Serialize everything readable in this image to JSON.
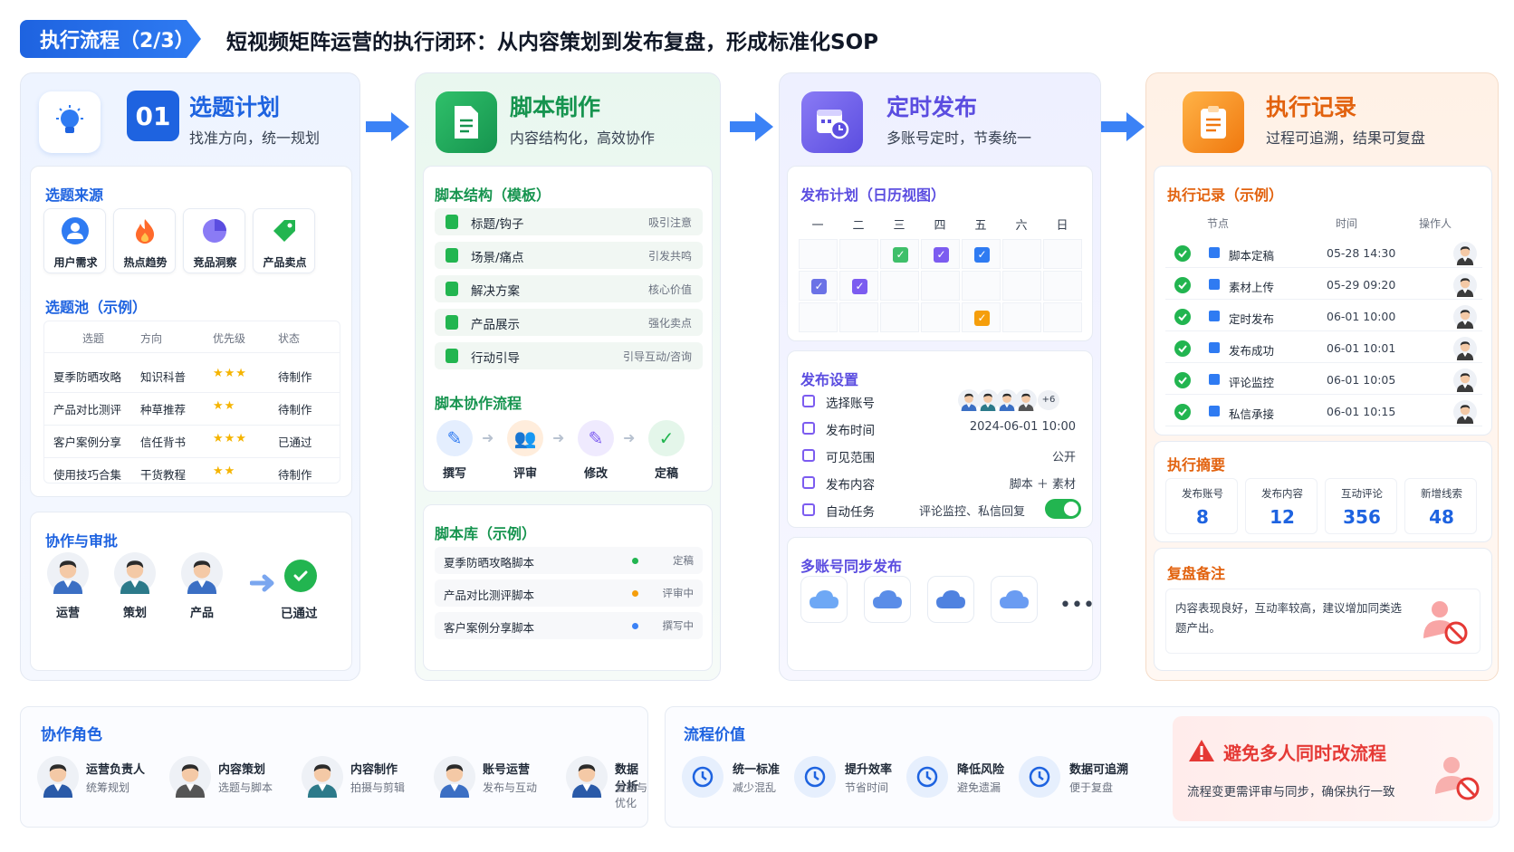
{
  "header": {
    "badge": "执行流程（2/3）",
    "title": "短视频矩阵运营的执行闭环：从内容策划到发布复盘，形成标准化SOP"
  },
  "colors": {
    "blue": "#1e63e0",
    "green": "#16944f",
    "purple": "#5b4de0",
    "orange": "#e2620e"
  },
  "step1": {
    "num": "01",
    "title": "选题计划",
    "subtitle": "找准方向，统一规划",
    "source_title": "选题来源",
    "sources": [
      {
        "label": "用户需求",
        "icon": "user-icon"
      },
      {
        "label": "热点趋势",
        "icon": "fire-icon"
      },
      {
        "label": "竞品洞察",
        "icon": "pie-chart-icon"
      },
      {
        "label": "产品卖点",
        "icon": "tag-icon"
      }
    ],
    "pool_title": "选题池（示例）",
    "pool_headers": [
      "选题",
      "方向",
      "优先级",
      "状态"
    ],
    "pool_rows": [
      {
        "topic": "夏季防晒攻略",
        "dir": "知识科普",
        "prio": "★★★",
        "status": "待制作"
      },
      {
        "topic": "产品对比测评",
        "dir": "种草推荐",
        "prio": "★★",
        "status": "待制作"
      },
      {
        "topic": "客户案例分享",
        "dir": "信任背书",
        "prio": "★★★",
        "status": "已通过"
      },
      {
        "topic": "使用技巧合集",
        "dir": "干货教程",
        "prio": "★★",
        "status": "待制作"
      }
    ],
    "approve_title": "协作与审批",
    "approvers": [
      "运营",
      "策划",
      "产品"
    ],
    "approved": "已通过"
  },
  "step2": {
    "title": "脚本制作",
    "subtitle": "内容结构化，高效协作",
    "struct_title": "脚本结构（模板）",
    "struct": [
      {
        "label": "标题/钩子",
        "note": "吸引注意"
      },
      {
        "label": "场景/痛点",
        "note": "引发共鸣"
      },
      {
        "label": "解决方案",
        "note": "核心价值"
      },
      {
        "label": "产品展示",
        "note": "强化卖点"
      },
      {
        "label": "行动引导",
        "note": "引导互动/咨询"
      }
    ],
    "flow_title": "脚本协作流程",
    "flow": [
      "撰写",
      "评审",
      "修改",
      "定稿"
    ],
    "lib_title": "脚本库（示例）",
    "lib": [
      {
        "name": "夏季防晒攻略脚本",
        "status": "定稿",
        "color": "#22b550"
      },
      {
        "name": "产品对比测评脚本",
        "status": "评审中",
        "color": "#f59e0b"
      },
      {
        "name": "客户案例分享脚本",
        "status": "撰写中",
        "color": "#3b82f6"
      }
    ]
  },
  "step3": {
    "title": "定时发布",
    "subtitle": "多账号定时，节奏统一",
    "cal_title": "发布计划（日历视图）",
    "weekdays": [
      "一",
      "二",
      "三",
      "四",
      "五",
      "六",
      "日"
    ],
    "settings_title": "发布设置",
    "settings": [
      {
        "label": "选择账号",
        "value": "+6"
      },
      {
        "label": "发布时间",
        "value": "2024-06-01  10:00"
      },
      {
        "label": "可见范围",
        "value": "公开"
      },
      {
        "label": "发布内容",
        "value": "脚本 ＋ 素材"
      },
      {
        "label": "自动任务",
        "value": "评论监控、私信回复"
      }
    ],
    "sync_title": "多账号同步发布"
  },
  "step4": {
    "title": "执行记录",
    "subtitle": "过程可追溯，结果可复盘",
    "log_title": "执行记录（示例）",
    "log_headers": [
      "节点",
      "时间",
      "操作人"
    ],
    "logs": [
      {
        "node": "脚本定稿",
        "time": "05-28 14:30"
      },
      {
        "node": "素材上传",
        "time": "05-29 09:20"
      },
      {
        "node": "定时发布",
        "time": "06-01 10:00"
      },
      {
        "node": "发布成功",
        "time": "06-01 10:01"
      },
      {
        "node": "评论监控",
        "time": "06-01 10:05"
      },
      {
        "node": "私信承接",
        "time": "06-01 10:15"
      }
    ],
    "summary_title": "执行摘要",
    "summary": [
      {
        "label": "发布账号",
        "value": "8"
      },
      {
        "label": "发布内容",
        "value": "12"
      },
      {
        "label": "互动评论",
        "value": "356"
      },
      {
        "label": "新增线索",
        "value": "48"
      }
    ],
    "review_title": "复盘备注",
    "review_text": "内容表现良好，互动率较高，建议增加同类选题产出。"
  },
  "roles": {
    "title": "协作角色",
    "items": [
      {
        "name": "运营负责人",
        "desc": "统筹规划"
      },
      {
        "name": "内容策划",
        "desc": "选题与脚本"
      },
      {
        "name": "内容制作",
        "desc": "拍摄与剪辑"
      },
      {
        "name": "账号运营",
        "desc": "发布与互动"
      },
      {
        "name": "数据分析",
        "desc": "复盘与优化"
      }
    ]
  },
  "value": {
    "title": "流程价值",
    "items": [
      {
        "name": "统一标准",
        "desc": "减少混乱"
      },
      {
        "name": "提升效率",
        "desc": "节省时间"
      },
      {
        "name": "降低风险",
        "desc": "避免遗漏"
      },
      {
        "name": "数据可追溯",
        "desc": "便于复盘"
      }
    ],
    "warn_title": "避免多人同时改流程",
    "warn_text": "流程变更需评审与同步，确保执行一致"
  }
}
